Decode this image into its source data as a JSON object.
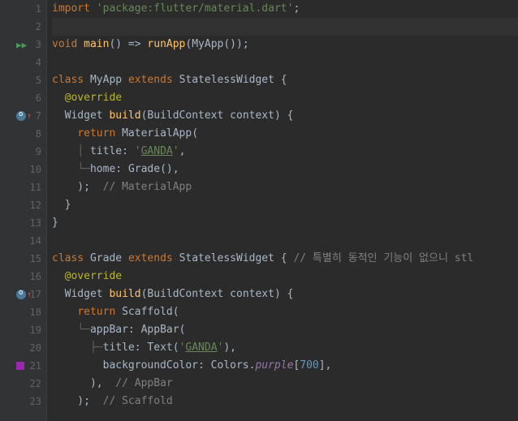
{
  "lines": [
    {
      "n": 1,
      "tokens": [
        {
          "t": "import ",
          "c": "kw"
        },
        {
          "t": "'package:flutter/material.dart'",
          "c": "str"
        },
        {
          "t": ";",
          "c": "op"
        }
      ]
    },
    {
      "n": 2,
      "highlight": true,
      "tokens": []
    },
    {
      "n": 3,
      "gutter": "play",
      "fold": "−",
      "tokens": [
        {
          "t": "void ",
          "c": "kw"
        },
        {
          "t": "main",
          "c": "fn"
        },
        {
          "t": "() => ",
          "c": "op"
        },
        {
          "t": "runApp",
          "c": "method"
        },
        {
          "t": "(",
          "c": "op"
        },
        {
          "t": "MyApp",
          "c": "cls"
        },
        {
          "t": "());",
          "c": "op"
        }
      ]
    },
    {
      "n": 4,
      "tokens": []
    },
    {
      "n": 5,
      "fold": "−",
      "tokens": [
        {
          "t": "class ",
          "c": "kw"
        },
        {
          "t": "MyApp ",
          "c": "cls"
        },
        {
          "t": "extends ",
          "c": "kw"
        },
        {
          "t": "StatelessWidget {",
          "c": "cls"
        }
      ]
    },
    {
      "n": 6,
      "tokens": [
        {
          "t": "  ",
          "c": ""
        },
        {
          "t": "@override",
          "c": "ann"
        }
      ]
    },
    {
      "n": 7,
      "gutter": "override",
      "fold": "−",
      "tokens": [
        {
          "t": "  Widget ",
          "c": "cls"
        },
        {
          "t": "build",
          "c": "fn"
        },
        {
          "t": "(BuildContext context) {",
          "c": "op"
        }
      ]
    },
    {
      "n": 8,
      "fold": "−",
      "tokens": [
        {
          "t": "    ",
          "c": ""
        },
        {
          "t": "return ",
          "c": "kw"
        },
        {
          "t": "MaterialApp",
          "c": "cls"
        },
        {
          "t": "(",
          "c": "op"
        }
      ]
    },
    {
      "n": 9,
      "tokens": [
        {
          "t": "    ",
          "c": ""
        },
        {
          "t": "│ ",
          "c": "tree"
        },
        {
          "t": "title: ",
          "c": "param"
        },
        {
          "t": "'",
          "c": "str"
        },
        {
          "t": "GANDA",
          "c": "str-u"
        },
        {
          "t": "'",
          "c": "str"
        },
        {
          "t": ",",
          "c": "op"
        }
      ]
    },
    {
      "n": 10,
      "tokens": [
        {
          "t": "    ",
          "c": ""
        },
        {
          "t": "└─",
          "c": "tree"
        },
        {
          "t": "home: ",
          "c": "param"
        },
        {
          "t": "Grade",
          "c": "cls"
        },
        {
          "t": "(),",
          "c": "op"
        }
      ]
    },
    {
      "n": 11,
      "fold": "end",
      "tokens": [
        {
          "t": "    );  ",
          "c": "op"
        },
        {
          "t": "// MaterialApp",
          "c": "cmt"
        }
      ]
    },
    {
      "n": 12,
      "fold": "end",
      "tokens": [
        {
          "t": "  }",
          "c": "op"
        }
      ]
    },
    {
      "n": 13,
      "fold": "end",
      "tokens": [
        {
          "t": "}",
          "c": "op"
        }
      ]
    },
    {
      "n": 14,
      "tokens": []
    },
    {
      "n": 15,
      "fold": "−",
      "tokens": [
        {
          "t": "class ",
          "c": "kw"
        },
        {
          "t": "Grade ",
          "c": "cls"
        },
        {
          "t": "extends ",
          "c": "kw"
        },
        {
          "t": "StatelessWidget { ",
          "c": "cls"
        },
        {
          "t": "// 특별히 동적인 기능이 없으니 stl",
          "c": "cmt"
        }
      ]
    },
    {
      "n": 16,
      "tokens": [
        {
          "t": "  ",
          "c": ""
        },
        {
          "t": "@override",
          "c": "ann"
        }
      ]
    },
    {
      "n": 17,
      "gutter": "override",
      "fold": "−",
      "tokens": [
        {
          "t": "  Widget ",
          "c": "cls"
        },
        {
          "t": "build",
          "c": "fn"
        },
        {
          "t": "(BuildContext context) {",
          "c": "op"
        }
      ]
    },
    {
      "n": 18,
      "fold": "−",
      "tokens": [
        {
          "t": "    ",
          "c": ""
        },
        {
          "t": "return ",
          "c": "kw"
        },
        {
          "t": "Scaffold",
          "c": "cls"
        },
        {
          "t": "(",
          "c": "op"
        }
      ]
    },
    {
      "n": 19,
      "fold": "−",
      "tokens": [
        {
          "t": "    ",
          "c": ""
        },
        {
          "t": "└─",
          "c": "tree"
        },
        {
          "t": "appBar: ",
          "c": "param"
        },
        {
          "t": "AppBar",
          "c": "cls"
        },
        {
          "t": "(",
          "c": "op"
        }
      ]
    },
    {
      "n": 20,
      "tokens": [
        {
          "t": "      ",
          "c": ""
        },
        {
          "t": "├─",
          "c": "tree"
        },
        {
          "t": "title: ",
          "c": "param"
        },
        {
          "t": "Text",
          "c": "cls"
        },
        {
          "t": "(",
          "c": "op"
        },
        {
          "t": "'",
          "c": "str"
        },
        {
          "t": "GANDA",
          "c": "str-u"
        },
        {
          "t": "'",
          "c": "str"
        },
        {
          "t": "),",
          "c": "op"
        }
      ]
    },
    {
      "n": 21,
      "gutter": "color",
      "tokens": [
        {
          "t": "        backgroundColor: Colors.",
          "c": "param"
        },
        {
          "t": "purple",
          "c": "field"
        },
        {
          "t": "[",
          "c": "op"
        },
        {
          "t": "700",
          "c": "num"
        },
        {
          "t": "],",
          "c": "op"
        }
      ]
    },
    {
      "n": 22,
      "fold": "end",
      "tokens": [
        {
          "t": "      ),  ",
          "c": "op"
        },
        {
          "t": "// AppBar",
          "c": "cmt"
        }
      ]
    },
    {
      "n": 23,
      "fold": "end",
      "tokens": [
        {
          "t": "    );  ",
          "c": "op"
        },
        {
          "t": "// Scaffold",
          "c": "cmt"
        }
      ]
    }
  ]
}
